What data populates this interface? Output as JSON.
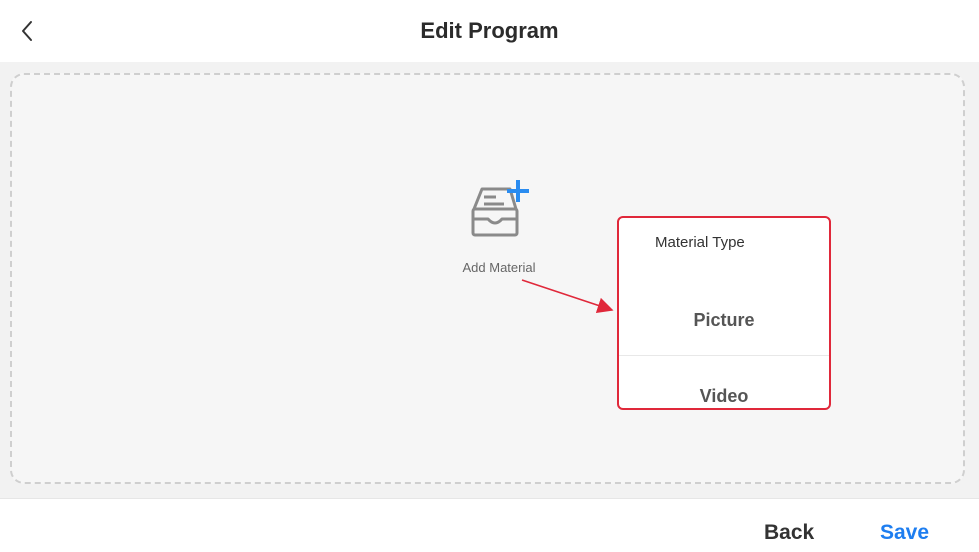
{
  "header": {
    "title": "Edit Program",
    "back_icon": "chevron-left-icon"
  },
  "main": {
    "add_material": {
      "label": "Add Material",
      "icon": "tray-add-icon",
      "plus_color": "#2a8cf0"
    },
    "material_type_menu": {
      "title": "Material Type",
      "options": [
        "Picture",
        "Video"
      ],
      "highlight_color": "#e0283a"
    }
  },
  "footer": {
    "back_label": "Back",
    "save_label": "Save",
    "save_color": "#1e7ef0"
  }
}
